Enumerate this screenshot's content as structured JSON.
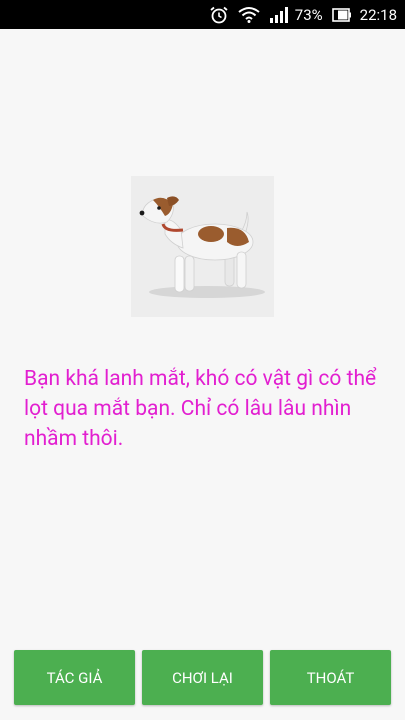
{
  "status_bar": {
    "battery_percent": "73%",
    "time": "22:18",
    "icons": [
      "alarm-clock-icon",
      "wifi-icon",
      "signal-icon",
      "battery-icon"
    ]
  },
  "main": {
    "image": {
      "subject": "dog-icon"
    },
    "result_text": "Bạn khá lanh mắt, khó có vật gì có thể lọt qua mắt bạn. Chỉ có lâu lâu nhìn nhầm thôi."
  },
  "buttons": {
    "author": "TÁC GIẢ",
    "replay": "CHƠI LẠI",
    "exit": "THOÁT"
  },
  "colors": {
    "accent_button": "#4caf50",
    "result_text": "#e21fd0",
    "background": "#f7f7f7"
  }
}
